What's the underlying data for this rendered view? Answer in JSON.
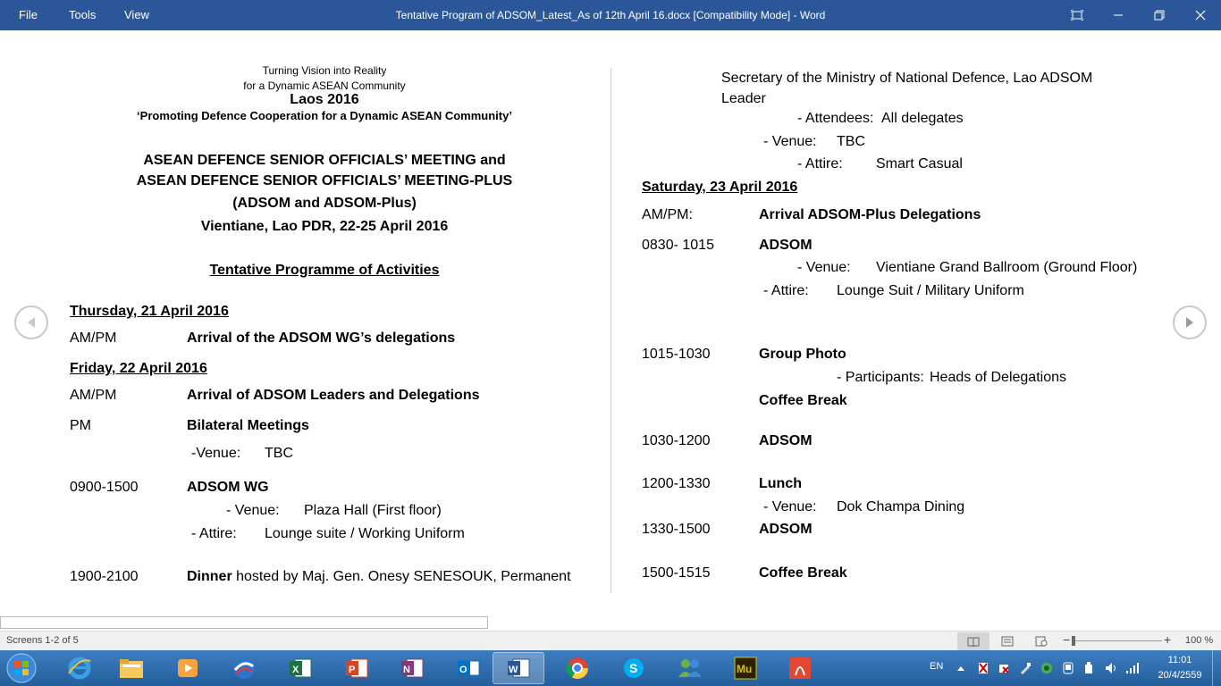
{
  "window": {
    "title": "Tentative Program of ADSOM_Latest_As of 12th April  16.docx [Compatibility Mode] - Word",
    "menu": [
      "File",
      "Tools",
      "View"
    ]
  },
  "doc_left": {
    "header1": "Turning Vision into Reality",
    "header2": "for a Dynamic ASEAN Community",
    "header3": "Laos 2016",
    "header4": "‘Promoting Defence Cooperation for a Dynamic ASEAN Community’",
    "title1": "ASEAN DEFENCE SENIOR OFFICIALS’ MEETING and",
    "title2": "ASEAN DEFENCE SENIOR OFFICIALS’ MEETING-PLUS",
    "title3": "(ADSOM and ADSOM-Plus)",
    "title4": "Vientiane, Lao PDR, 22-25 April 2016",
    "programme": "Tentative Programme of Activities",
    "thu_date": "Thursday, 21 April 2016",
    "thu_time": "AM/PM",
    "thu_event": "Arrival of the ADSOM WG’s delegations",
    "fri_date": "Friday, 22 April 2016",
    "fri1_time": "AM/PM",
    "fri1_event": "Arrival of ADSOM Leaders and Delegations",
    "fri2_time": "PM",
    "fri2_event": "Bilateral Meetings",
    "fri2_venue_label": "-Venue:",
    "fri2_venue": "TBC",
    "fri3_time": "0900-1500",
    "fri3_event": "ADSOM WG",
    "fri3_venue_label": "- Venue:",
    "fri3_venue": "Plaza Hall (First floor)",
    "fri3_attire_label": "- Attire:",
    "fri3_attire": "Lounge suite / Working Uniform",
    "fri4_time": "1900-2100",
    "fri4_event_bold": "Dinner",
    "fri4_event_rest": " hosted by Maj. Gen. Onesy SENESOUK, Permanent"
  },
  "doc_right": {
    "cont1": "Secretary of the Ministry of National Defence, Lao ADSOM",
    "cont2": "Leader",
    "attendees_label": "- Attendees:",
    "attendees": "All delegates",
    "venue1_label": "- Venue:",
    "venue1": "TBC",
    "attire1_label": "- Attire:",
    "attire1": "Smart Casual",
    "sat_date": "Saturday, 23 April 2016",
    "sat1_time": "AM/PM:",
    "sat1_event": "Arrival ADSOM-Plus Delegations",
    "sat2_time": "0830- 1015",
    "sat2_event": "ADSOM",
    "sat2_venue_label": "- Venue:",
    "sat2_venue": "Vientiane Grand Ballroom (Ground Floor)",
    "sat2_attire_label": "- Attire:",
    "sat2_attire": "Lounge Suit / Military Uniform",
    "sat3_time": "1015-1030",
    "sat3_event": "Group Photo",
    "sat3_part_label": "- Participants:",
    "sat3_part": "Heads of Delegations",
    "sat3_event2": "Coffee Break",
    "sat4_time": "1030-1200",
    "sat4_event": "ADSOM",
    "sat5_time": "1200-1330",
    "sat5_event": "Lunch",
    "sat5_venue_label": "- Venue:",
    "sat5_venue": "Dok Champa Dining",
    "sat6_time": "1330-1500",
    "sat6_event": "ADSOM",
    "sat7_time": "1500-1515",
    "sat7_event": "Coffee Break"
  },
  "status": {
    "screens": "Screens 1-2 of 5",
    "zoom": "100 %"
  },
  "taskbar": {
    "lang": "EN",
    "time": "11:01",
    "date": "20/4/2559",
    "apps": [
      "Internet Explorer",
      "File Explorer",
      "Media Player",
      "Skype Alt",
      "Excel",
      "PowerPoint",
      "OneNote",
      "Outlook",
      "Word",
      "Chrome",
      "Skype",
      "Messenger",
      "Muse",
      "Acrobat"
    ]
  }
}
